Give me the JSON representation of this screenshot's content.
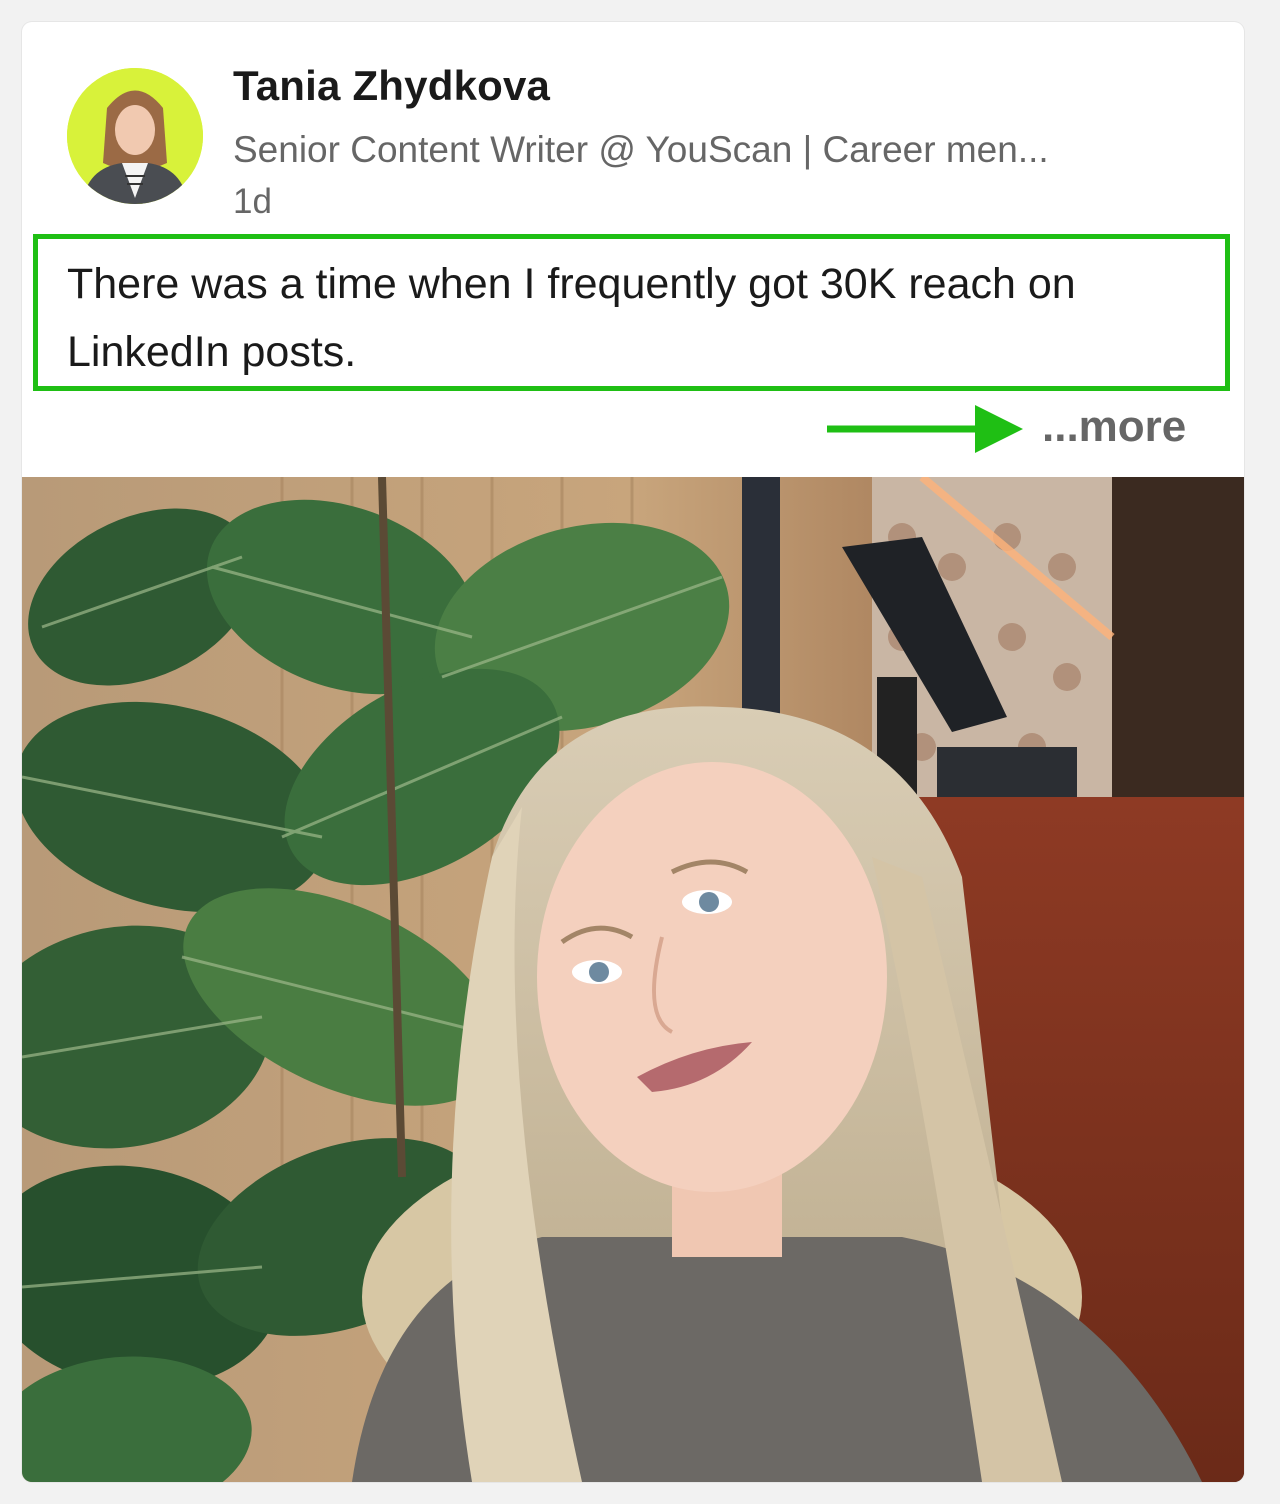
{
  "post": {
    "author": {
      "name": "Tania Zhydkova",
      "headline": "Senior Content Writer @ YouScan | Career men...",
      "time": "1d"
    },
    "text": "There was a time when I frequently got 30K reach on LinkedIn posts.",
    "more_label": "...more",
    "image_description_icon": "selfie-photo"
  },
  "colors": {
    "highlight": "#1fbf14",
    "avatar_background": "#d8f23a",
    "secondary_text": "#666666"
  }
}
